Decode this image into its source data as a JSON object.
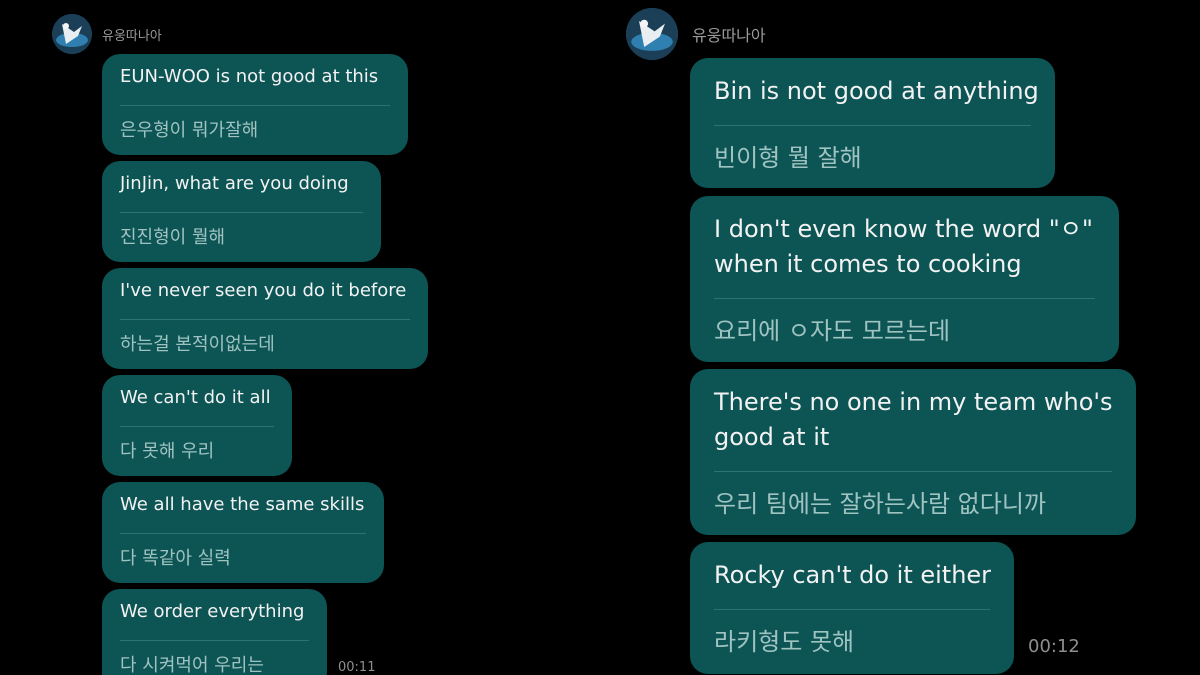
{
  "left": {
    "sender": "유웅따나아",
    "time": "00:11",
    "messages": [
      {
        "en": "EUN-WOO is not good at this",
        "ko": "은우형이 뭐가잘해"
      },
      {
        "en": "JinJin, what are you doing",
        "ko": "진진형이 뭘해"
      },
      {
        "en": "I've never seen you do it before",
        "ko": "하는걸 본적이없는데"
      },
      {
        "en": "We can't do it all",
        "ko": "다 못해 우리"
      },
      {
        "en": "We all have the same skills",
        "ko": "다 똑같아 실력"
      },
      {
        "en": "We order everything",
        "ko": "다 시켜먹어 우리는"
      }
    ]
  },
  "right": {
    "sender": "유웅따나아",
    "time": "00:12",
    "messages": [
      {
        "en": "Bin is not good at anything",
        "ko": "빈이형 뭘 잘해"
      },
      {
        "en": "I don't even know the word \"ㅇ\" when it comes to cooking",
        "ko": "요리에 ㅇ자도 모르는데"
      },
      {
        "en": "There's no one in my team who's good at it",
        "ko": "우리 팀에는 잘하는사람 없다니까"
      },
      {
        "en": "Rocky can't do it either",
        "ko": "라키형도 못해"
      }
    ]
  },
  "colors": {
    "background": "#000000",
    "bubble": "#0d5454",
    "divider": "#2c7474",
    "korean_text": "#9fc3c1"
  }
}
